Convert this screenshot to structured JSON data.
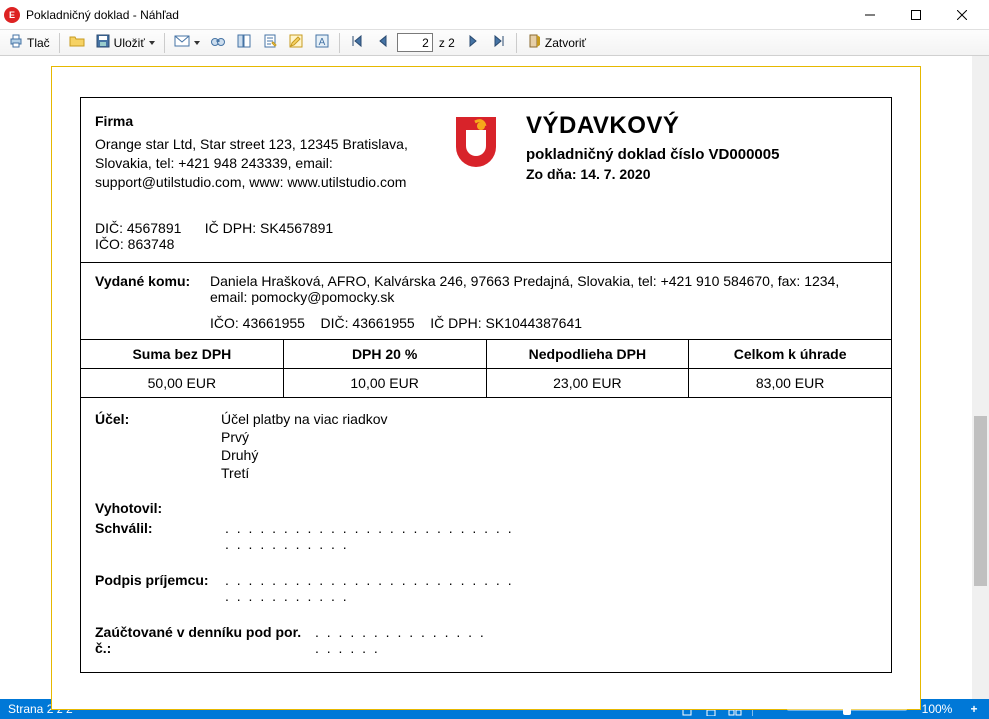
{
  "window": {
    "title": "Pokladničný doklad - Náhľad"
  },
  "toolbar": {
    "print": "Tlač",
    "save": "Uložiť",
    "page_current": "2",
    "page_total": "z 2",
    "close": "Zatvoriť"
  },
  "doc": {
    "company": {
      "label": "Firma",
      "line": "Orange star Ltd, Star street 123, 12345 Bratislava, Slovakia, tel: +421 948 243339, email: support@utilstudio.com, www: www.utilstudio.com",
      "dic_label": "DIČ:",
      "dic": "4567891",
      "icdph_label": "IČ DPH:",
      "icdph": "SK4567891",
      "ico_label": "IČO:",
      "ico": "863748"
    },
    "head": {
      "title": "VÝDAVKOVÝ",
      "subtitle": "pokladničný doklad číslo VD000005",
      "date": "Zo dňa: 14. 7. 2020"
    },
    "issued": {
      "label": "Vydané komu:",
      "body": "Daniela Hrašková, AFRO, Kalvárska 246, 97663 Predajná, Slovakia, tel: +421 910 584670, fax: 1234, email: pomocky@pomocky.sk",
      "ids": "IČO: 43661955    DIČ: 43661955    IČ DPH: SK1044387641"
    },
    "sums": {
      "h1": "Suma bez DPH",
      "v1": "50,00 EUR",
      "h2": "DPH 20 %",
      "v2": "10,00 EUR",
      "h3": "Nedpodlieha DPH",
      "v3": "23,00 EUR",
      "h4": "Celkom k úhrade",
      "v4": "83,00 EUR"
    },
    "purpose": {
      "label": "Účel:",
      "line1": "Účel platby na viac riadkov",
      "line2": "Prvý",
      "line3": "Druhý",
      "line4": "Tretí"
    },
    "sig": {
      "vyhotovil": "Vyhotovil:",
      "schvalil": "Schválil:",
      "podpis": "Podpis príjemcu:",
      "zauctovane": "Zaúčtované v denníku pod por. č.:",
      "dots": ". . . . . . . . . . . . . . . . . . . . . . . . . . . . . . . . . . . ."
    }
  },
  "status": {
    "left": "Strana 2 z 2",
    "zoom": "100%"
  }
}
